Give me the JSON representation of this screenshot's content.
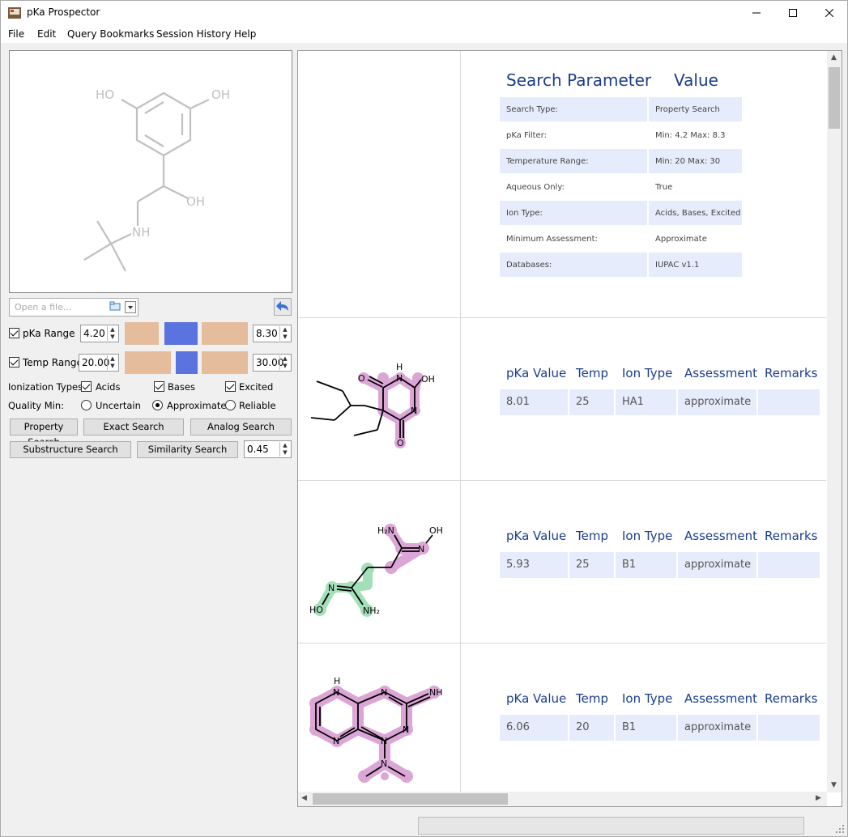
{
  "app": {
    "title": "pKa Prospector"
  },
  "menu": [
    "File",
    "Edit",
    "Query Bookmarks",
    "Session History",
    "Help"
  ],
  "query_molecule": {
    "atom_labels": [
      "HO",
      "OH",
      "OH",
      "NH"
    ]
  },
  "file": {
    "placeholder": "Open a file..."
  },
  "pka_range": {
    "label": "pKa Range",
    "min": "4.20",
    "max": "8.30",
    "checked": true
  },
  "temp_range": {
    "label": "Temp Range",
    "min": "20.00",
    "max": "30.00",
    "checked": true
  },
  "ionization": {
    "label": "Ionization Types:",
    "options": [
      "Acids",
      "Bases",
      "Excited"
    ]
  },
  "quality": {
    "label": "Quality Min:",
    "options": [
      "Uncertain",
      "Approximate",
      "Reliable"
    ],
    "selected": "Approximate"
  },
  "buttons": {
    "property_search": "Property Search",
    "exact_search": "Exact Search",
    "analog_search": "Analog Search",
    "substructure_search": "Substructure Search",
    "similarity_search": "Similarity Search",
    "similarity_value": "0.45"
  },
  "params": {
    "header_param": "Search Parameter",
    "header_value": "Value",
    "rows": [
      {
        "param": "Search Type:",
        "value": "Property Search"
      },
      {
        "param": "pKa Filter:",
        "value": "Min: 4.2 Max: 8.3"
      },
      {
        "param": "Temperature Range:",
        "value": "Min: 20 Max: 30"
      },
      {
        "param": "Aqueous Only:",
        "value": "True"
      },
      {
        "param": "Ion Type:",
        "value": "Acids, Bases, Excited"
      },
      {
        "param": "Minimum Assessment:",
        "value": "Approximate"
      },
      {
        "param": "Databases:",
        "value": "IUPAC v1.1"
      }
    ]
  },
  "results": {
    "columns": [
      "pKa Value",
      "Temp",
      "Ion Type",
      "Assessment",
      "Remarks"
    ],
    "rows": [
      {
        "pka": "8.01",
        "temp": "25",
        "ion": "HA1",
        "assessment": "approximate",
        "remarks": "",
        "atoms": [
          "O",
          "H",
          "N",
          "OH",
          "N",
          "O"
        ]
      },
      {
        "pka": "5.93",
        "temp": "25",
        "ion": "B1",
        "assessment": "approximate",
        "remarks": "",
        "atoms": [
          "H₂N",
          "N",
          "OH",
          "N",
          "HO",
          "NH₂"
        ]
      },
      {
        "pka": "6.06",
        "temp": "20",
        "ion": "B1",
        "assessment": "approximate",
        "remarks": "",
        "atoms": [
          "H",
          "N",
          "N",
          "N",
          "NH",
          "N",
          "N",
          "N"
        ]
      }
    ]
  },
  "colors": {
    "accent": "#1a3d8f",
    "highlight_pink": "#dba6d6",
    "highlight_green": "#a3e0b8",
    "range_slider": "#5a73de"
  }
}
